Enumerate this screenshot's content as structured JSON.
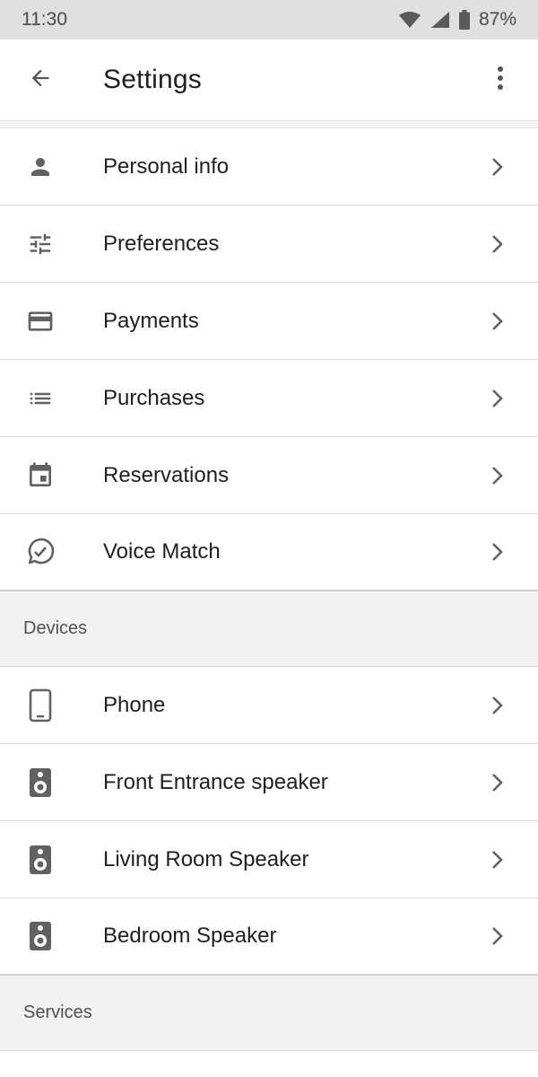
{
  "status_bar": {
    "time": "11:30",
    "battery": "87%"
  },
  "app_bar": {
    "title": "Settings"
  },
  "account_items": [
    {
      "label": "Personal info",
      "icon": "person-icon"
    },
    {
      "label": "Preferences",
      "icon": "tune-icon"
    },
    {
      "label": "Payments",
      "icon": "credit-card-icon"
    },
    {
      "label": "Purchases",
      "icon": "list-icon"
    },
    {
      "label": "Reservations",
      "icon": "calendar-icon"
    },
    {
      "label": "Voice Match",
      "icon": "voice-match-icon"
    }
  ],
  "devices": {
    "header": "Devices",
    "items": [
      {
        "label": "Phone",
        "icon": "phone-icon"
      },
      {
        "label": "Front Entrance speaker",
        "icon": "speaker-icon"
      },
      {
        "label": "Living Room Speaker",
        "icon": "speaker-icon"
      },
      {
        "label": "Bedroom Speaker",
        "icon": "speaker-icon"
      }
    ]
  },
  "services": {
    "header": "Services"
  },
  "colors": {
    "icon": "#616161",
    "divider": "#dcdcdc",
    "section_bg": "#f2f2f2"
  }
}
